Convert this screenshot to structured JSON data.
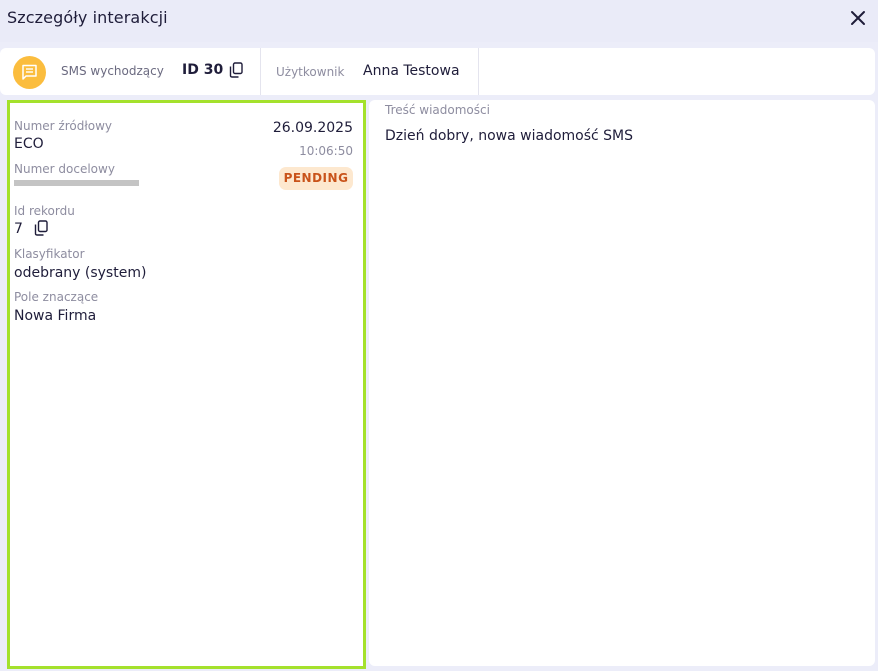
{
  "window": {
    "title": "Szczegóły interakcji",
    "close_icon": "close-icon"
  },
  "info_bar": {
    "type_icon": "sms-message-icon",
    "type_icon_color": "#fbbd3e",
    "type_label": "SMS wychodzący",
    "id_label": "ID 30",
    "copy_icon": "copy-icon",
    "user_label": "Użytkownik",
    "user_name": "Anna Testowa"
  },
  "details": {
    "source_label": "Numer źródłowy",
    "source_value": "ECO",
    "target_label": "Numer docelowy",
    "date": "26.09.2025",
    "time": "10:06:50",
    "status": "PENDING",
    "status_color": "#c9531a",
    "record_label": "Id rekordu",
    "record_value": "7",
    "classifier_label": "Klasyfikator",
    "classifier_value": "odebrany (system)",
    "field_label": "Pole znaczące",
    "field_value": "Nowa Firma"
  },
  "message": {
    "label": "Treść wiadomości",
    "body": "Dzień dobry, nowa wiadomość SMS"
  },
  "colors": {
    "accent_highlight": "#a4e12c",
    "background": "#ecedf9"
  }
}
